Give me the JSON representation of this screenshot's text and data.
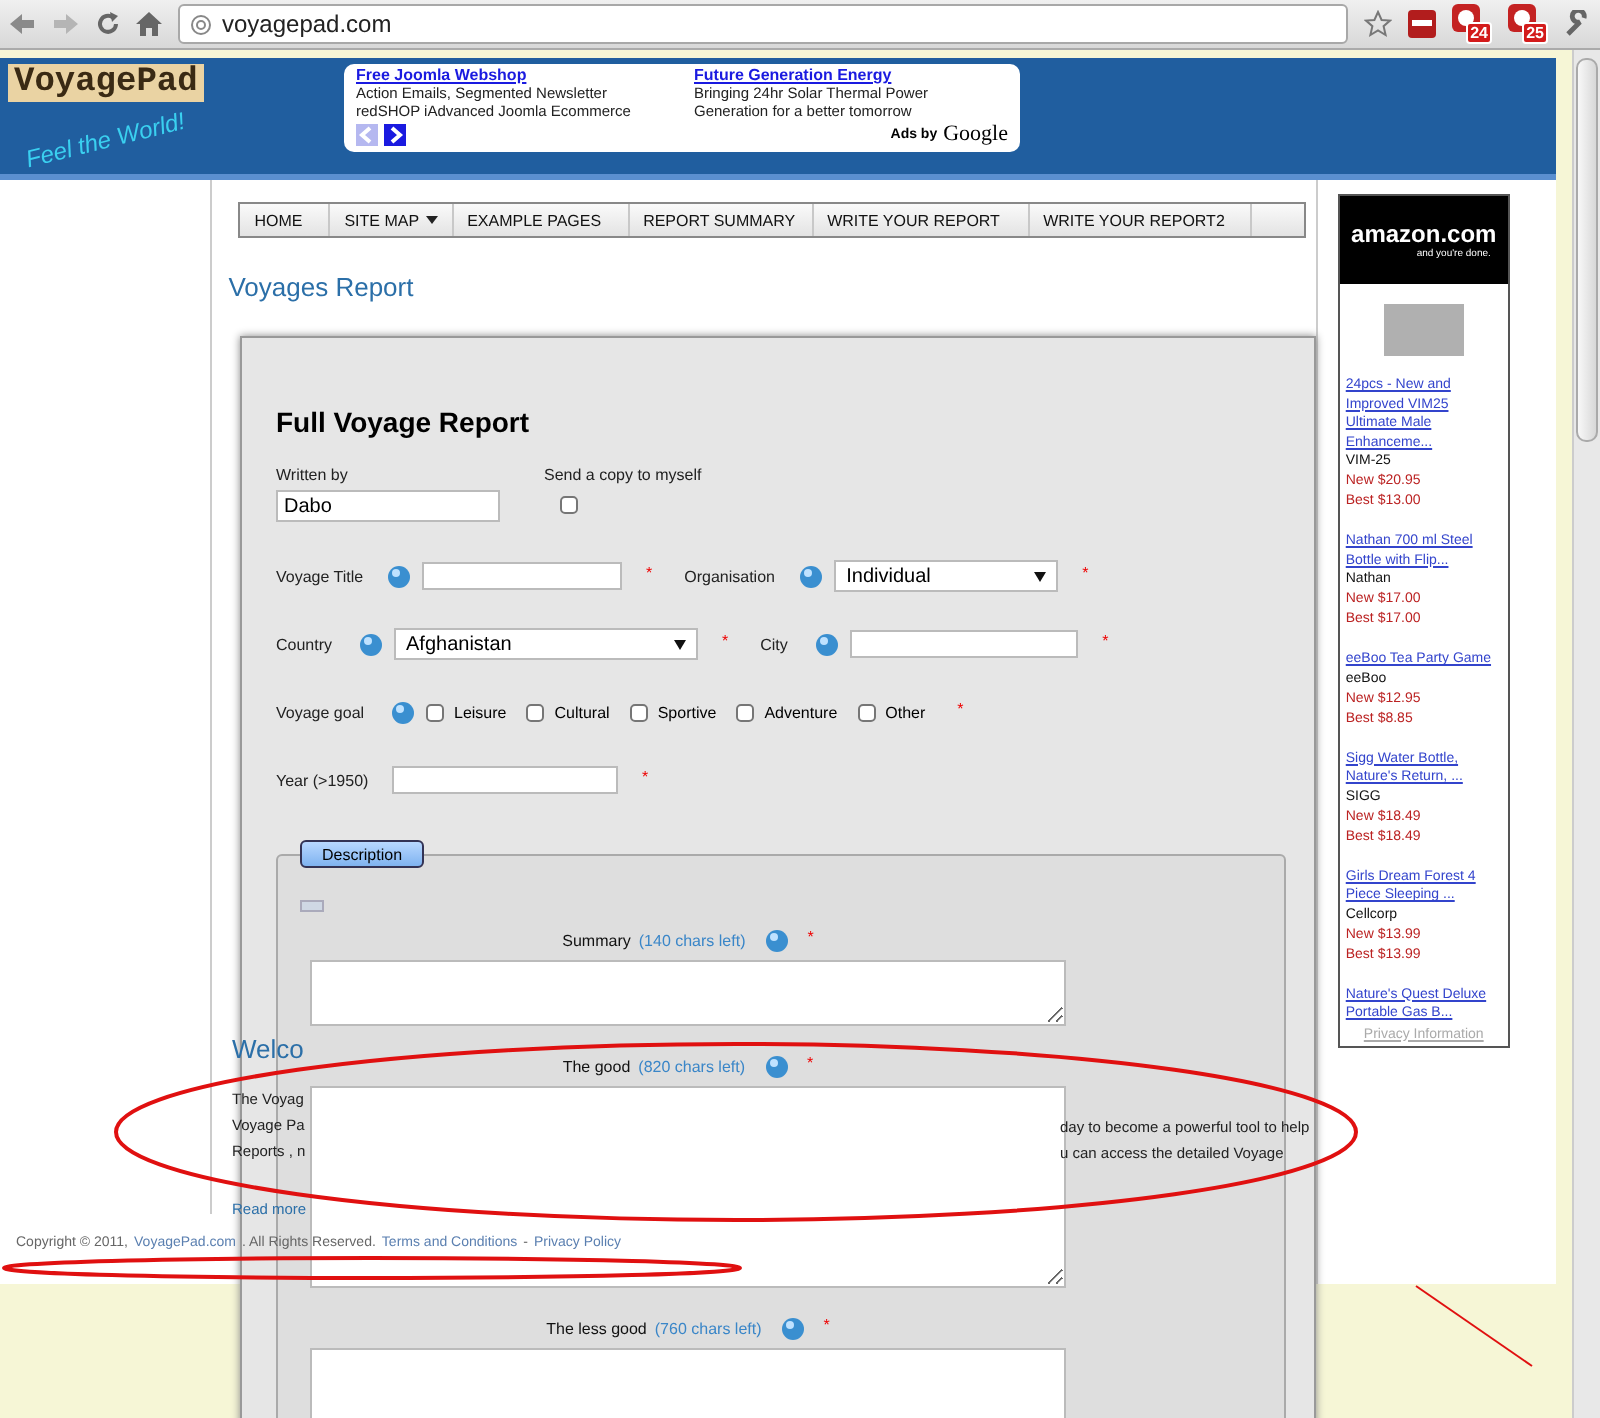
{
  "browser": {
    "url": "voyagepad.com",
    "badges": [
      "24",
      "25"
    ]
  },
  "header": {
    "logo": "VoyagePad",
    "tagline": "Feel the World!",
    "ads": [
      {
        "title": "Free Joomla Webshop",
        "line1": "Action Emails, Segmented Newsletter",
        "line2": "redSHOP iAdvanced Joomla Ecommerce"
      },
      {
        "title": "Future Generation Energy",
        "line1": "Bringing 24hr Solar Thermal Power",
        "line2": "Generation for a better tomorrow"
      }
    ],
    "ads_by": "Ads by",
    "ads_brand": "Google"
  },
  "nav": {
    "items": [
      {
        "label": "HOME",
        "dropdown": false
      },
      {
        "label": "SITE MAP",
        "dropdown": true
      },
      {
        "label": "EXAMPLE PAGES",
        "dropdown": false
      },
      {
        "label": "REPORT SUMMARY",
        "dropdown": false
      },
      {
        "label": "WRITE YOUR REPORT",
        "dropdown": false
      },
      {
        "label": "WRITE YOUR REPORT2",
        "dropdown": false
      }
    ]
  },
  "page_title": "Voyages Report",
  "welcome": {
    "heading": "Welco",
    "left_lines": [
      "The Voyag",
      "Voyage Pa",
      "Reports , n"
    ],
    "read_more": "Read more",
    "right_lines": [
      "day to become a powerful tool to help",
      "u can access the detailed Voyage"
    ]
  },
  "footer": {
    "parts": [
      {
        "text": "Copyright © 2011,",
        "link": false
      },
      {
        "text": "VoyagePad.com",
        "link": true
      },
      {
        "text": ". All Rights Reserved.",
        "link": false
      },
      {
        "text": "Terms and Conditions",
        "link": true
      },
      {
        "text": "-",
        "link": false
      },
      {
        "text": "Privacy Policy",
        "link": true
      }
    ]
  },
  "sidebar_ad": {
    "logo": "amazon.com",
    "tagline": "and you're done.",
    "products": [
      {
        "title": "24pcs - New and Improved VIM25 Ultimate Male Enhanceme...",
        "brand": "VIM-25",
        "new_price": "New $20.95",
        "best_price": "Best $13.00"
      },
      {
        "title": "Nathan 700 ml Steel Bottle with Flip...",
        "brand": "Nathan",
        "new_price": "New $17.00",
        "best_price": "Best $17.00"
      },
      {
        "title": "eeBoo Tea Party Game",
        "brand": "eeBoo",
        "new_price": "New $12.95",
        "best_price": "Best $8.85"
      },
      {
        "title": "Sigg Water Bottle, Nature's Return, ...",
        "brand": "SIGG",
        "new_price": "New $18.49",
        "best_price": "Best $18.49"
      },
      {
        "title": "Girls Dream Forest 4 Piece Sleeping ...",
        "brand": "Cellcorp",
        "new_price": "New $13.99",
        "best_price": "Best $13.99"
      },
      {
        "title": "Nature's Quest Deluxe Portable Gas B..."
      }
    ],
    "privacy": "Privacy Information"
  },
  "modal": {
    "title": "Full Voyage Report",
    "written_by": {
      "label": "Written by",
      "value": "Dabo"
    },
    "send_copy": {
      "label": "Send a copy to myself",
      "checked": false
    },
    "rows": [
      {
        "fields": [
          {
            "kind": "text",
            "label": "Voyage Title",
            "help": true,
            "required_mark": "*"
          },
          {
            "kind": "select",
            "label": "Organisation",
            "help": true,
            "value": "Individual",
            "required_mark": "*"
          }
        ]
      },
      {
        "fields": [
          {
            "kind": "select",
            "label": "Country",
            "help": true,
            "value": "Afghanistan",
            "required_mark": "*"
          },
          {
            "kind": "text",
            "label": "City",
            "help": true,
            "required_mark": "*"
          }
        ]
      },
      {
        "fields": [
          {
            "kind": "checkboxes",
            "label": "Voyage goal",
            "help": true,
            "options": [
              {
                "label": "Leisure",
                "checked": false
              },
              {
                "label": "Cultural",
                "checked": false
              },
              {
                "label": "Sportive",
                "checked": false
              },
              {
                "label": "Adventure",
                "checked": false
              },
              {
                "label": "Other",
                "checked": false
              }
            ],
            "required_mark": "*"
          }
        ]
      },
      {
        "fields": [
          {
            "kind": "text",
            "label": "Year (>1950)",
            "help": false,
            "required_mark": "*"
          }
        ]
      }
    ],
    "tab": "Description",
    "text_areas": [
      {
        "label": "Summary",
        "counter": "(140 chars left)",
        "required_mark": "*"
      },
      {
        "label": "The good",
        "counter": "(820 chars left)",
        "required_mark": "*"
      },
      {
        "label": "The less good",
        "counter": "(760 chars left)",
        "required_mark": "*"
      }
    ]
  }
}
